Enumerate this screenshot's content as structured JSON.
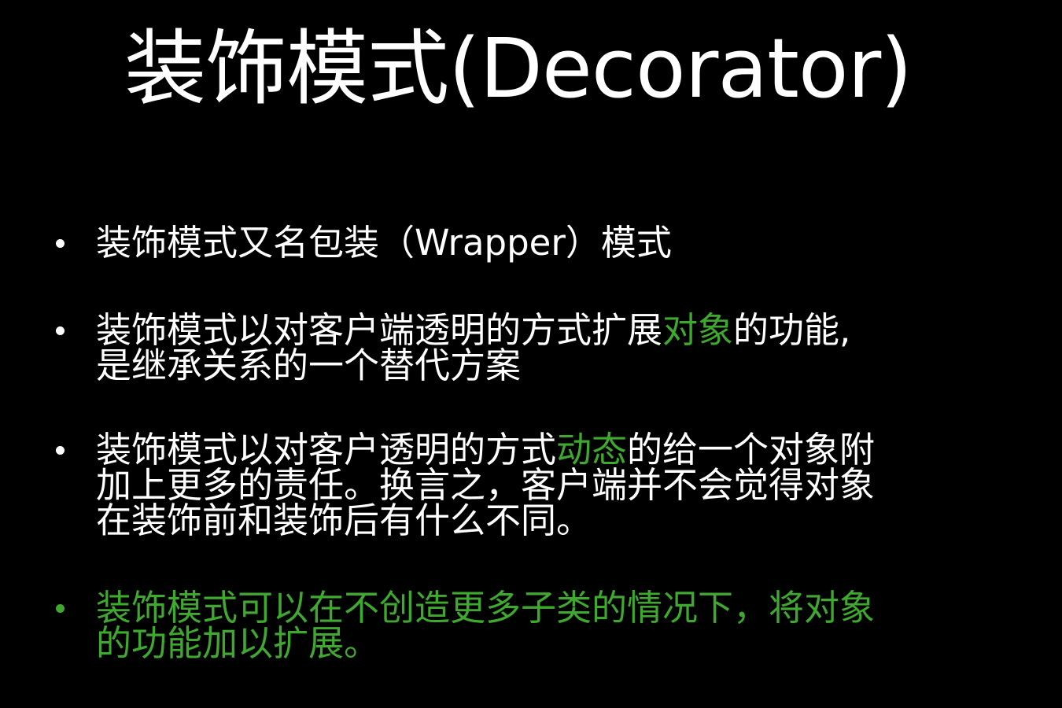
{
  "slide": {
    "title": "装饰模式(Decorator)",
    "accent_color": "#3fa82f",
    "bullets": [
      {
        "lines": [
          "装饰模式又名包装（Wrapper）模式"
        ]
      },
      {
        "line1_pre": "装饰模式以对客户端透明的方式扩展",
        "line1_highlight": "对象",
        "line1_post": "的功能,",
        "line2": "是继承关系的一个替代方案"
      },
      {
        "line1_pre": "装饰模式以对客户透明的方式",
        "line1_highlight": "动态",
        "line1_post": "的给一个对象附",
        "line2": "加上更多的责任。换言之，客户端并不会觉得对象",
        "line3": "在装饰前和装饰后有什么不同。"
      },
      {
        "line1": "装饰模式可以在不创造更多子类的情况下，将对象",
        "line2": "的功能加以扩展。"
      }
    ]
  }
}
